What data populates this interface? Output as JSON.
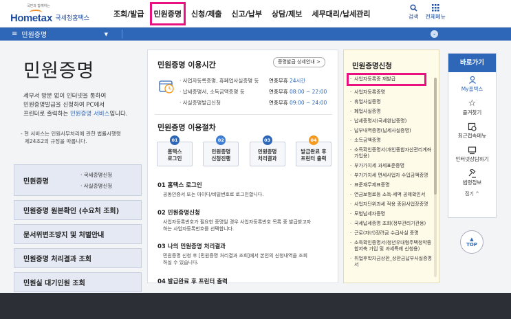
{
  "header": {
    "logo": {
      "tagline": "국민과 함께하는",
      "home": "Home",
      "tax": "tax",
      "agency": "국세청홈택스"
    },
    "nav": [
      "조회/발급",
      "민원증명",
      "신청/제출",
      "신고/납부",
      "상담/제보",
      "세무대리/납세관리"
    ],
    "tools": {
      "search": "검색",
      "all_menu": "전체메뉴"
    }
  },
  "menubar": {
    "label": "민원증명"
  },
  "left": {
    "title": "민원증명",
    "desc1": "세무서 방문 없이 인터넷을 통하여",
    "desc2": "민원증명발급을 신청하여 PC에서",
    "desc3_pre": "프린터로 출력하는 ",
    "desc3_link": "민원증명 서비스",
    "desc3_post": "입니다.",
    "note1": "- 현 서비스는 민원사무처리에 관한 법률시행령",
    "note2": "제24조2의 규정을 따릅니다.",
    "menu": {
      "m1": "민원증명",
      "m1_sub1": "· 국세증명신청",
      "m1_sub2": "· 사실증명신청",
      "m2": "민원증명 원본확인 (수요처 조회)",
      "m3": "문서위변조방지 및 처벌안내",
      "m4": "민원증명 처리결과 조회",
      "m5": "민원실 대기인원 조회"
    }
  },
  "center": {
    "hours_title": "민원증명 이용시간",
    "detail_btn": "증명발급 상세안내 >",
    "rows": [
      {
        "label": "· 사업자등록증명, 휴폐업사실증명 등",
        "val_pre": "연중무휴 ",
        "val_hl": "24시간"
      },
      {
        "label": "· 납세증명서, 소득금액증명 등",
        "val_pre": "연중무휴 ",
        "val_hl": "08:00 ~ 22:00"
      },
      {
        "label": "· 사실증명발급신청",
        "val_pre": "연중무휴 ",
        "val_hl": "09:00 ~ 24:00"
      }
    ],
    "proc_title": "민원증명 이용절차",
    "steps": [
      {
        "num": "01",
        "l1": "홈택스",
        "l2": "로그인"
      },
      {
        "num": "02",
        "l1": "민원증명",
        "l2": "신청진행"
      },
      {
        "num": "03",
        "l1": "민원증명",
        "l2": "처리결과"
      },
      {
        "num": "04",
        "l1": "발급완료 후",
        "l2": "프린터 출력"
      }
    ],
    "p1_t": "01 홈택스 로그인",
    "p1_d1": "공동인증서 또는 아이디/비밀번호로 로그인합니다.",
    "p2_t": "02 민원증명신청",
    "p2_d1": "사업자등록번호가 필요한 증명일 경우 사업자등록번호 목록 중 발급받고자",
    "p2_d2": "하는 사업자등록번호를 선택합니다.",
    "p3_t": "03 나의 민원증명 처리결과",
    "p3_d1": "민원증명 신청 후 [민원증명 처리결과 조회]에서 본인의 신청내역을 조회",
    "p3_d2": "하실 수 있습니다.",
    "p4_t": "04 발급완료 후 프린터 출력"
  },
  "right": {
    "title": "민원증명신청",
    "items": [
      "사업자등록증 재발급",
      "사업자등록증명",
      "휴업사실증명",
      "폐업사실증명",
      "납세증명서(국세완납증명)",
      "납부내역증명(납세사실증명)",
      "소득금액증명",
      "소득확인증명서(개인종합자산관리계좌 가입용)",
      "부가가치세 과세표준증명",
      "부가가치세 면세사업자 수입금액증명",
      "표준재무제표증명",
      "연금보험료등 소득·세액 공제확인서",
      "사업자단위과세 적용 종된사업장증명",
      "모범납세자증명",
      "국세납세증명 조회(정부관리기관용)",
      "근로(자녀)장려금 수급사실 증명",
      "소득확인증명서(청년우대형주택청약종합저축 가입 및 과세특례 신청용)",
      "취업후학자금상환_상환금납부사실증명서"
    ]
  },
  "quick": {
    "title": "바로가기",
    "items": [
      "My홈택스",
      "즐겨찾기",
      "최근접속메뉴",
      "인터넷상담하기",
      "법령정보"
    ],
    "fold": "접기 ^",
    "top": "TOP"
  },
  "colors": {
    "brand": "#2e66b8",
    "highlight": "#e8117f",
    "step1": "#2e66b8",
    "step2": "#3f7fd6",
    "step3": "#2e66b8",
    "step4": "#f39b1f"
  }
}
